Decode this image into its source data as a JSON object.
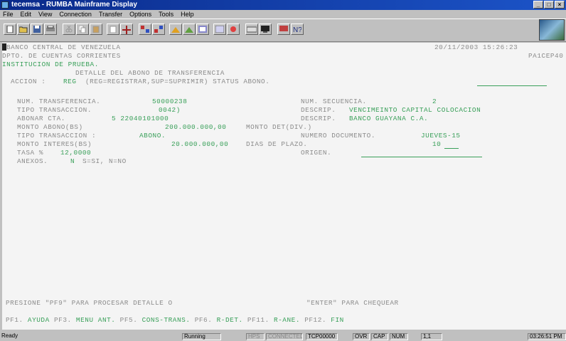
{
  "window": {
    "title": "tecemsa - RUMBA Mainframe Display"
  },
  "menu": {
    "items": [
      "File",
      "Edit",
      "View",
      "Connection",
      "Transfer",
      "Options",
      "Tools",
      "Help"
    ]
  },
  "screen": {
    "header_left_1": "BANCO CENTRAL DE VENEZUELA",
    "datetime": "20/11/2003 15:26:23",
    "header_left_2": "DPTO. DE CUENTAS CORRIENTES",
    "program_id": "PA1CEP40",
    "institution": "INSTITUCION DE PRUEBA.",
    "screen_title": "DETALLE DEL ABONO DE TRANSFERENCIA",
    "accion_label": "ACCION :",
    "accion_value": "REG",
    "accion_help": "(REG=REGISTRAR,SUP=SUPRIMIR) STATUS ABONO.",
    "fields": {
      "num_transferencia": {
        "label": "NUM. TRANSFERENCIA.",
        "value": "50000238"
      },
      "num_secuencia": {
        "label": "NUM. SECUENCIA.",
        "value": "2"
      },
      "tipo_transaccion": {
        "label": "TIPO TRANSACCION.",
        "value": "0042)"
      },
      "descrip_1": {
        "label": "DESCRIP.",
        "value": "VENCIMEINTO CAPITAL COLOCACION"
      },
      "abonar_cta": {
        "label": "ABONAR CTA.",
        "value": "5 22040101000"
      },
      "descrip_2": {
        "label": "DESCRIP.",
        "value": "BANCO GUAYANA C.A."
      },
      "monto_abono": {
        "label": "MONTO ABONO(BS)",
        "value": "200.000.000,00"
      },
      "monto_det": {
        "label": "MONTO DET(DIV.)",
        "value": ""
      },
      "tipo_transaccion_2": {
        "label": "TIPO TRANSACCION :",
        "value": "ABONO."
      },
      "numero_documento": {
        "label": "NUMERO DOCUMENTO.",
        "value": "JUEVES-15"
      },
      "monto_intereses": {
        "label": "MONTO INTERES(BS)",
        "value": "20.000.000,00"
      },
      "dias_de_plazo": {
        "label": "DIAS DE PLAZO.",
        "value": "10"
      },
      "tasa": {
        "label": "TASA %",
        "value": "12,0000"
      },
      "origen": {
        "label": "ORIGEN.",
        "value": ""
      },
      "anexos": {
        "label": "ANEXOS.",
        "value": "N",
        "help": "S=SI, N=NO"
      }
    },
    "prompt": "PRESIONE \"PF9\" PARA PROCESAR DETALLE O",
    "prompt_2": "\"ENTER\" PARA CHEQUEAR",
    "pf_keys": [
      {
        "key": "PF1.",
        "label": "AYUDA"
      },
      {
        "key": "PF3.",
        "label": "MENU ANT."
      },
      {
        "key": "PF5.",
        "label": "CONS-TRANS."
      },
      {
        "key": "PF6.",
        "label": "R-DET."
      },
      {
        "key": "PF11.",
        "label": "R-ANE."
      },
      {
        "key": "PF12.",
        "label": "FIN"
      }
    ]
  },
  "statusbar": {
    "ready": "Ready",
    "state": "Running",
    "hps": "HPS",
    "connected": "CONNECTED",
    "session": "TCP00000",
    "ovr": "OVR",
    "cap": "CAP",
    "num": "NUM",
    "position": "1,1",
    "time": "03:26:51 PM"
  }
}
